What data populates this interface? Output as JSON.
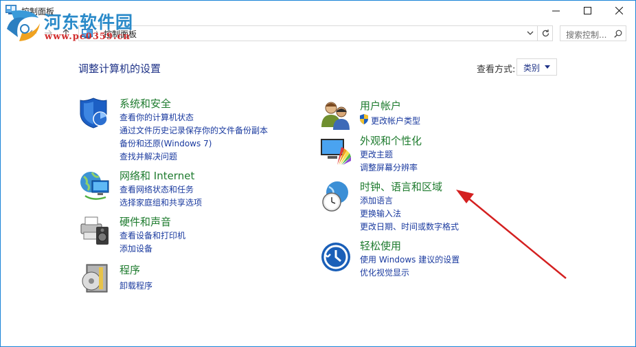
{
  "window": {
    "title": "控制面板",
    "minimize_glyph": "—",
    "maximize_glyph": "☐",
    "close_glyph": "✕"
  },
  "address": {
    "path": "控制面板",
    "separator": "›"
  },
  "search": {
    "placeholder": "搜索控制..."
  },
  "watermark": {
    "title": "河东软件园",
    "url": "www.pc0359.cn"
  },
  "heading": "调整计算机的设置",
  "view_by": {
    "label": "查看方式:",
    "value": "类别"
  },
  "categories_left": [
    {
      "title": "系统和安全",
      "icon": "shield-icon",
      "links": [
        "查看你的计算机状态",
        "通过文件历史记录保存你的文件备份副本",
        "备份和还原(Windows 7)",
        "查找并解决问题"
      ]
    },
    {
      "title": "网络和 Internet",
      "icon": "globe-network-icon",
      "links": [
        "查看网络状态和任务",
        "选择家庭组和共享选项"
      ]
    },
    {
      "title": "硬件和声音",
      "icon": "printer-speaker-icon",
      "links": [
        "查看设备和打印机",
        "添加设备"
      ]
    },
    {
      "title": "程序",
      "icon": "programs-disc-icon",
      "links": [
        "卸载程序"
      ]
    }
  ],
  "categories_right": [
    {
      "title": "用户帐户",
      "icon": "users-icon",
      "links": [
        "更改帐户类型"
      ]
    },
    {
      "title": "外观和个性化",
      "icon": "monitor-palette-icon",
      "links": [
        "更改主题",
        "调整屏幕分辨率"
      ]
    },
    {
      "title": "时钟、语言和区域",
      "icon": "clock-globe-icon",
      "links": [
        "添加语言",
        "更换输入法",
        "更改日期、时间或数字格式"
      ]
    },
    {
      "title": "轻松使用",
      "icon": "ease-of-access-icon",
      "links": [
        "使用 Windows 建议的设置",
        "优化视觉显示"
      ]
    }
  ],
  "colors": {
    "category_title": "#1e7b2e",
    "link": "#1a3a9f",
    "heading": "#1e3287",
    "annotation_arrow": "#d42020"
  }
}
